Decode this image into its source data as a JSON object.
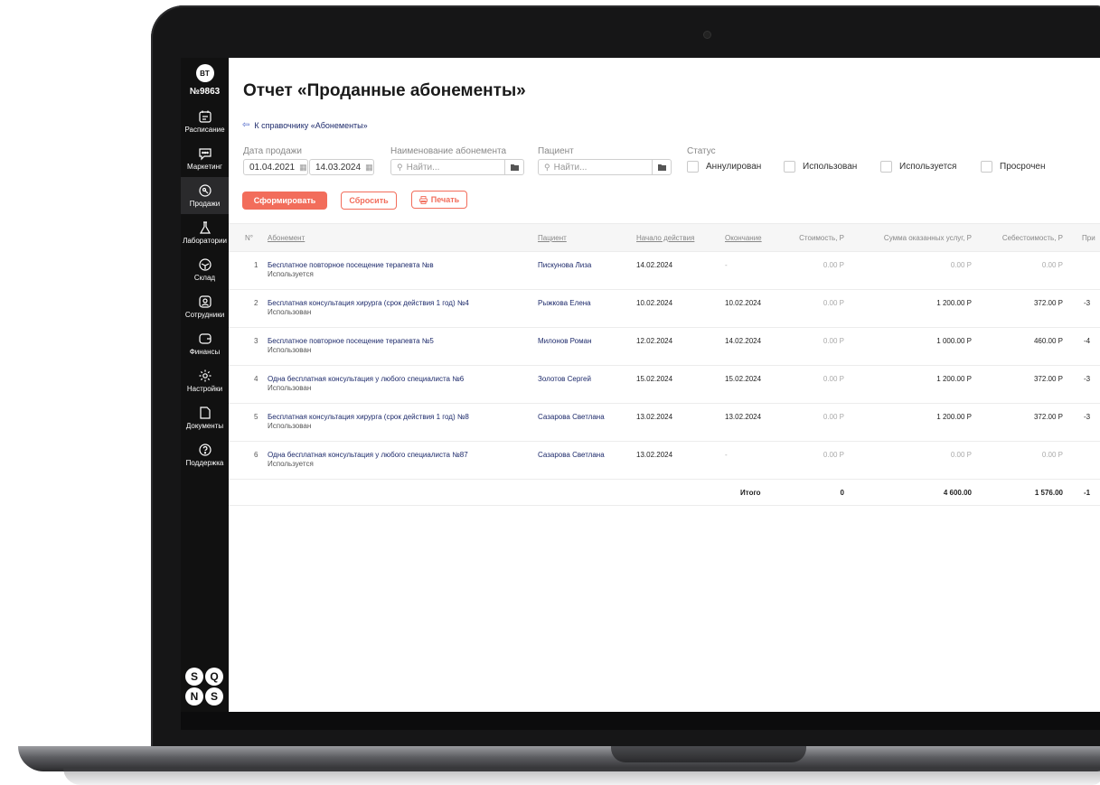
{
  "account": {
    "initials": "BT",
    "number": "№9863"
  },
  "sidebar": {
    "items": [
      {
        "label": "Расписание",
        "icon": "calendar-icon"
      },
      {
        "label": "Маркетинг",
        "icon": "chat-icon"
      },
      {
        "label": "Продажи",
        "icon": "tag-icon",
        "active": true
      },
      {
        "label": "Лаборатории",
        "icon": "flask-icon"
      },
      {
        "label": "Склад",
        "icon": "box-icon"
      },
      {
        "label": "Сотрудники",
        "icon": "user-icon"
      },
      {
        "label": "Финансы",
        "icon": "wallet-icon"
      },
      {
        "label": "Настройки",
        "icon": "gear-icon"
      },
      {
        "label": "Документы",
        "icon": "document-icon"
      },
      {
        "label": "Поддержка",
        "icon": "help-icon"
      }
    ]
  },
  "brand": {
    "logo": "sqns-logo"
  },
  "page": {
    "title": "Отчет «Проданные абонементы»",
    "back_link": "К справочнику «Абонементы»"
  },
  "filters": {
    "sale_date_label": "Дата продажи",
    "date_from": "01.04.2021",
    "date_to": "14.03.2024",
    "subscription_label": "Наименование абонемента",
    "subscription_placeholder": "Найти...",
    "patient_label": "Пациент",
    "patient_placeholder": "Найти...",
    "status_label": "Статус",
    "statuses": [
      "Аннулирован",
      "Использован",
      "Используется",
      "Просрочен"
    ]
  },
  "actions": {
    "generate": "Сформировать",
    "reset": "Сбросить",
    "print": "Печать"
  },
  "table": {
    "columns": [
      "N°",
      "Абонемент",
      "Пациент",
      "Начало действия",
      "Окончание",
      "Стоимость, Р",
      "Сумма оказанных услуг, Р",
      "Себестоимость, Р",
      "При"
    ],
    "rows": [
      {
        "n": "1",
        "name": "Бесплатное повторное посещение терапевта №в",
        "status": "Используется",
        "patient": "Пискунова Лиза",
        "start": "14.02.2024",
        "end": "-",
        "cost": "0.00 Р",
        "services": "0.00 Р",
        "prime": "0.00 Р",
        "profit": ""
      },
      {
        "n": "2",
        "name": "Бесплатная консультация хирурга (срок действия 1 год) №4",
        "status": "Использован",
        "patient": "Рыжкова Елена",
        "start": "10.02.2024",
        "end": "10.02.2024",
        "cost": "0.00 Р",
        "services": "1 200.00 Р",
        "prime": "372.00 Р",
        "profit": "-3"
      },
      {
        "n": "3",
        "name": "Бесплатное повторное посещение терапевта №5",
        "status": "Использован",
        "patient": "Милонов Роман",
        "start": "12.02.2024",
        "end": "14.02.2024",
        "cost": "0.00 Р",
        "services": "1 000.00 Р",
        "prime": "460.00 Р",
        "profit": "-4"
      },
      {
        "n": "4",
        "name": "Одна бесплатная консультация у любого специалиста №6",
        "status": "Использован",
        "patient": "Золотов Сергей",
        "start": "15.02.2024",
        "end": "15.02.2024",
        "cost": "0.00 Р",
        "services": "1 200.00 Р",
        "prime": "372.00 Р",
        "profit": "-3"
      },
      {
        "n": "5",
        "name": "Бесплатная консультация хирурга (срок действия 1 год) №8",
        "status": "Использован",
        "patient": "Сазарова Светлана",
        "start": "13.02.2024",
        "end": "13.02.2024",
        "cost": "0.00 Р",
        "services": "1 200.00 Р",
        "prime": "372.00 Р",
        "profit": "-3"
      },
      {
        "n": "6",
        "name": "Одна бесплатная консультация у любого специалиста №87",
        "status": "Используется",
        "patient": "Сазарова Светлана",
        "start": "13.02.2024",
        "end": "-",
        "cost": "0.00 Р",
        "services": "0.00 Р",
        "prime": "0.00 Р",
        "profit": ""
      }
    ],
    "total": {
      "label": "Итого",
      "cost": "0",
      "services": "4 600.00",
      "prime": "1 576.00",
      "profit": "-1"
    }
  }
}
